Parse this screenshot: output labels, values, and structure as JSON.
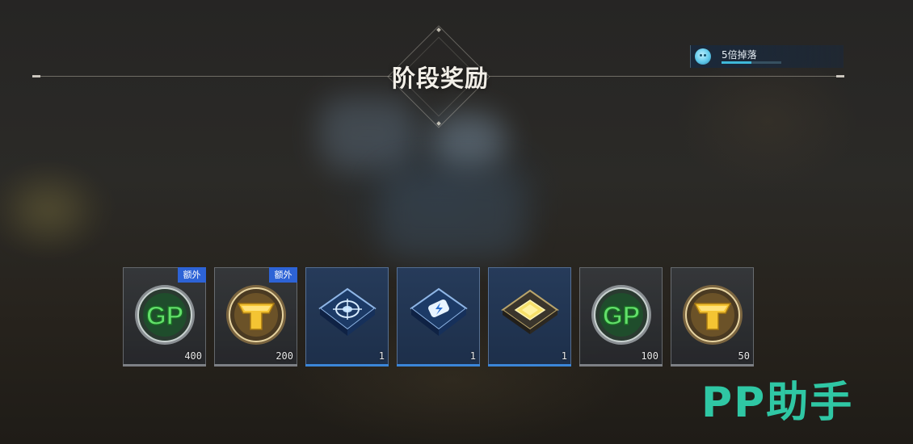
{
  "header": {
    "title": "阶段奖励"
  },
  "drop_bonus": {
    "label": "5倍掉落",
    "progress": 0.5
  },
  "rewards": [
    {
      "name": "GP",
      "icon": "gp-coin-icon",
      "quantity": "400",
      "tag": "额外",
      "rarity": "gray"
    },
    {
      "name": "T-coin",
      "icon": "t-coin-icon",
      "quantity": "200",
      "tag": "额外",
      "rarity": "gray"
    },
    {
      "name": "Chip (target)",
      "icon": "target-chip-icon",
      "quantity": "1",
      "rarity": "blue"
    },
    {
      "name": "Chip (battery)",
      "icon": "battery-chip-icon",
      "quantity": "1",
      "rarity": "blue"
    },
    {
      "name": "Chip (gold)",
      "icon": "gold-chip-icon",
      "quantity": "1",
      "rarity": "blue"
    },
    {
      "name": "GP",
      "icon": "gp-coin-icon",
      "quantity": "100",
      "rarity": "gray"
    },
    {
      "name": "T-coin",
      "icon": "t-coin-icon",
      "quantity": "50",
      "rarity": "gray"
    }
  ],
  "gp_text": "GP",
  "watermark": "PP助手",
  "colors": {
    "accent_blue": "#3b86d8",
    "extra_tag": "#2d63d6",
    "watermark": "#2fc7a4"
  }
}
